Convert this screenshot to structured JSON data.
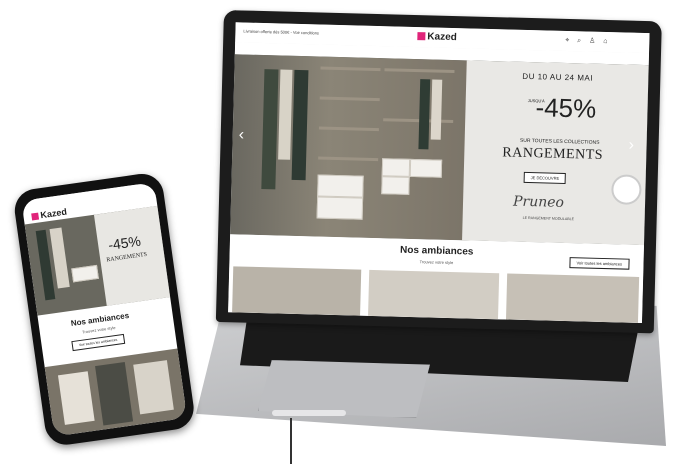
{
  "laptop": {
    "promo_line": "Livraison offerte dès 500€ - Voir conditions",
    "logo_text": "Kazed",
    "nav_items": [
      "LA MARQUE",
      "AMBIANCES",
      "PORTES COULISSANTES",
      "DRESSINGS",
      "LITS",
      "RÉCOPRECOPTES",
      "RÉMUNÉRATIONS",
      "NOUVEAUTÉS",
      "SERVICES"
    ],
    "hero": {
      "date": "DU 10 AU 24 MAI",
      "up_to": "JUSQU'À",
      "percent": "-45%",
      "sub_line1": "SUR TOUTES LES COLLECTIONS",
      "big": "RANGEMENTS",
      "cta": "JE DÉCOUVRE",
      "signature": "Pruneo",
      "signature_caption": "LE RANGEMENT MODULABLE"
    },
    "section": {
      "title": "Nos ambiances",
      "subtitle": "Trouvez votre style",
      "cta": "Voir toutes les ambiances"
    }
  },
  "phone": {
    "logo_text": "Kazed",
    "hero_percent": "-45%",
    "hero_big": "RANGEMENTS",
    "section_title": "Nos ambiances",
    "section_sub": "Trouvez votre style",
    "section_cta": "Voir toutes les ambiances"
  },
  "colors": {
    "brand": "#e0247a",
    "dark": "#1c1c1c",
    "aluminium": "#c4c5c8"
  }
}
